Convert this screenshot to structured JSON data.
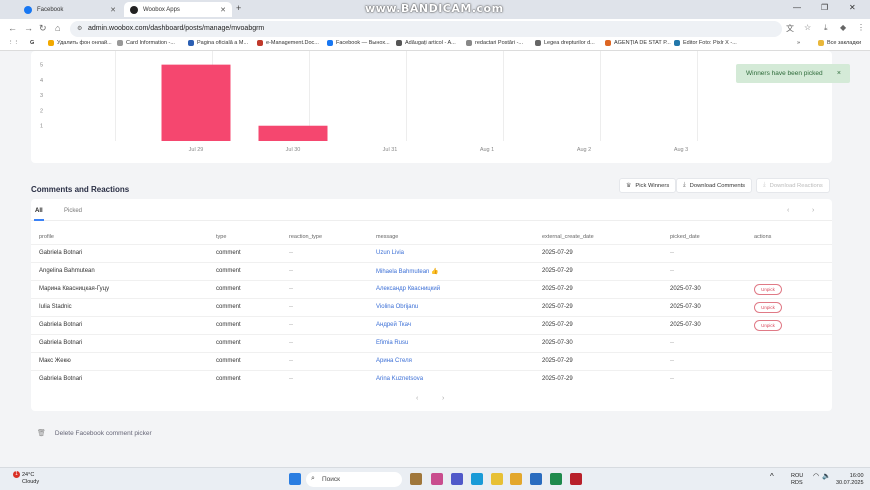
{
  "browser": {
    "tabs": [
      {
        "title": "Facebook",
        "active": false
      },
      {
        "title": "Woobox Apps",
        "active": true
      }
    ],
    "watermark": "www.BANDICAM.com",
    "url": "admin.woobox.com/dashboard/posts/manage/mvoabgrm",
    "bookmarks": [
      "Удалить фон онлай...",
      "Card Information -...",
      "Pagina oficială a M...",
      "e-Management.Doc...",
      "Facebook — Вынох...",
      "Adăugați articol - A...",
      "redactari Postări -...",
      "Legea drepturilor d...",
      "AGENȚIA DE STAT P...",
      "Editor Foto: Pixlr X -..."
    ],
    "bookmarks_all": "Все закладки"
  },
  "chart_data": {
    "type": "bar",
    "categories": [
      "Jul 29",
      "Jul 30",
      "Jul 31",
      "Aug 1",
      "Aug 2",
      "Aug 3"
    ],
    "values": [
      5,
      1,
      0,
      0,
      0,
      0
    ],
    "yticks": [
      "5",
      "4",
      "3",
      "2",
      "1"
    ],
    "ylim": [
      0,
      5.5
    ],
    "color": "#f5476f"
  },
  "toast": {
    "message": "Winners have been picked",
    "close": "×"
  },
  "section": {
    "title": "Comments and Reactions"
  },
  "actions": {
    "pick_winners": "Pick Winners",
    "download_comments": "Download Comments",
    "download_reactions": "Download Reactions"
  },
  "filter_tabs": [
    "All",
    "Picked"
  ],
  "pager": {
    "prev": "‹",
    "next": "›"
  },
  "table": {
    "headers": [
      "profile",
      "type",
      "reaction_type",
      "message",
      "external_create_date",
      "picked_date",
      "actions"
    ],
    "rows": [
      {
        "profile": "Gabriela Botnari",
        "type": "comment",
        "reaction_type": "--",
        "message": "Uzun Livia",
        "created": "2025-07-29",
        "picked": "--",
        "action": ""
      },
      {
        "profile": "Angelina Bahmutean",
        "type": "comment",
        "reaction_type": "--",
        "message": "Mihaela Bahmutean 👍",
        "created": "2025-07-29",
        "picked": "--",
        "action": ""
      },
      {
        "profile": "Марина Квасницкая-Гуцу",
        "type": "comment",
        "reaction_type": "--",
        "message": "Александр Квасницкий",
        "created": "2025-07-29",
        "picked": "2025-07-30",
        "action": "Unpick"
      },
      {
        "profile": "Iulia Stadnic",
        "type": "comment",
        "reaction_type": "--",
        "message": "Violina Obrijanu",
        "created": "2025-07-29",
        "picked": "2025-07-30",
        "action": "Unpick"
      },
      {
        "profile": "Gabriela Botnari",
        "type": "comment",
        "reaction_type": "--",
        "message": "Андрей Ткач",
        "created": "2025-07-29",
        "picked": "2025-07-30",
        "action": "Unpick"
      },
      {
        "profile": "Gabriela Botnari",
        "type": "comment",
        "reaction_type": "--",
        "message": "Efimia Rusu",
        "created": "2025-07-30",
        "picked": "--",
        "action": ""
      },
      {
        "profile": "Макс Жекю",
        "type": "comment",
        "reaction_type": "--",
        "message": "Арина Стеля",
        "created": "2025-07-29",
        "picked": "--",
        "action": ""
      },
      {
        "profile": "Gabriela Botnari",
        "type": "comment",
        "reaction_type": "--",
        "message": "Arina Kuznetsova",
        "created": "2025-07-29",
        "picked": "--",
        "action": ""
      }
    ]
  },
  "delete_link": "Delete Facebook comment picker",
  "taskbar": {
    "temperature": "24°C",
    "weather": "Cloudy",
    "notifications": "1",
    "search": "Поиск",
    "lang1": "ROU",
    "lang2": "RDS",
    "time": "16:00",
    "date": "30.07.2025"
  }
}
